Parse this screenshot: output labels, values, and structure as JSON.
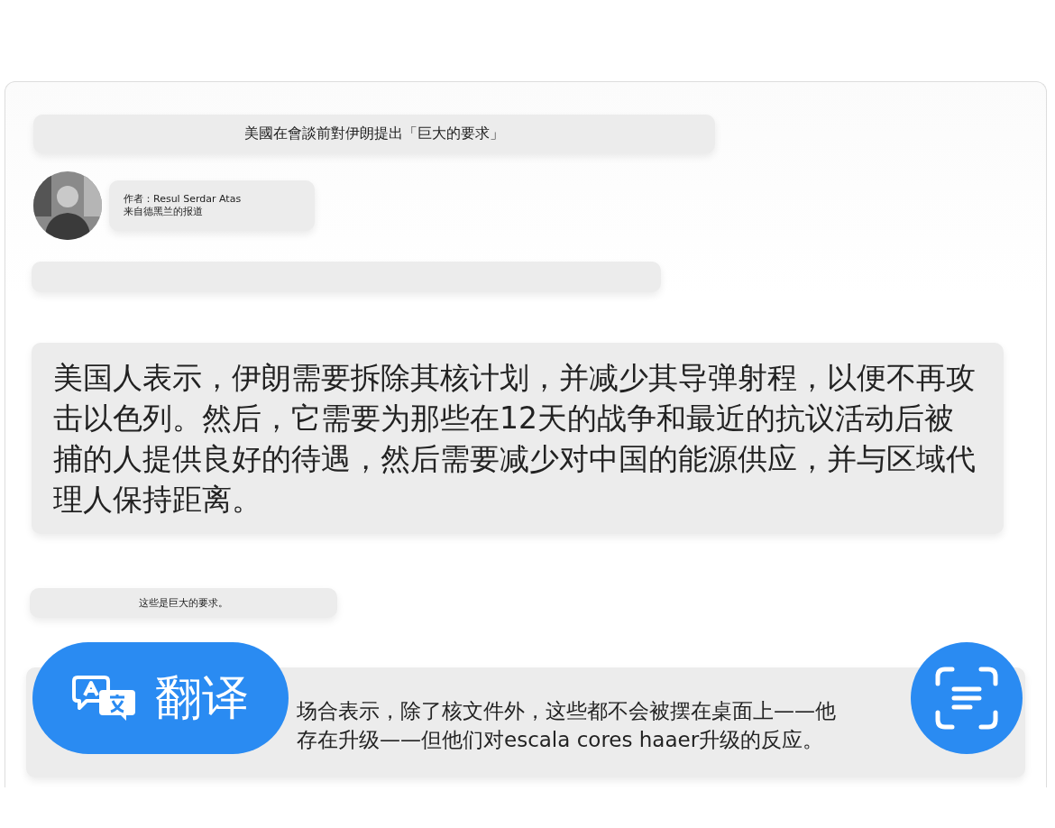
{
  "headline": "美國在會談前對伊朗提出「巨大的要求」",
  "author": {
    "byline": "作者：Resul Serdar Atas",
    "dateline": "来自德黑兰的报道"
  },
  "quote": "美国人表示，伊朗需要拆除其核计划，并减少其导弹射程，以便不再攻击以色列。然后，它需要为那些在12天的战争和最近的抗议活动后被捕的人提供良好的待遇，然后需要减少对中国的能源供应，并与区域代理人保持距离。",
  "caption": "这些是巨大的要求。",
  "paragraph_lines": [
    "场合表示，除了核文件外，这些都不会被摆在桌面上——他",
    "存在升级——但他们对escala cores haaer升级的反应。"
  ],
  "translate_button": {
    "label": "翻译"
  }
}
